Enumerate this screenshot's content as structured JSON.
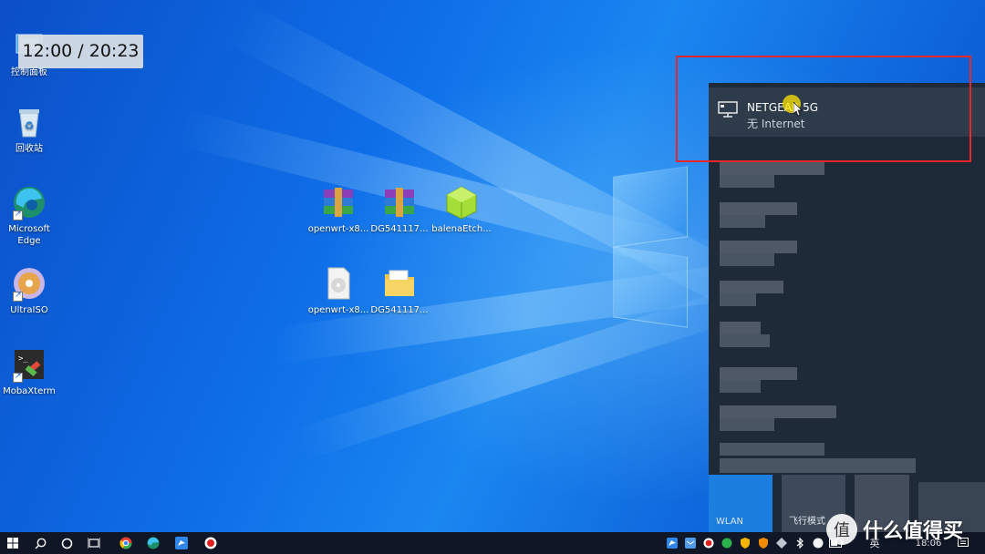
{
  "overlay": {
    "timer": "12:00 / 20:23"
  },
  "desktop_icons": {
    "control_panel": "控制面板",
    "recycle_bin": "回收站",
    "edge": "Microsoft Edge",
    "ultraiso": "UltraISO",
    "mobaxterm": "MobaXterm",
    "openwrt_archive": "openwrt-x8...",
    "dg_archive": "DG541117...",
    "balena": "balenaEtch...",
    "openwrt_image": "openwrt-x8...",
    "dg_folder": "DG541117..."
  },
  "network_flyout": {
    "selected_network": {
      "name": "NETGEAR 5G",
      "status": "无 Internet"
    },
    "quick_actions": {
      "wlan": "WLAN",
      "airplane": "飞行模式"
    }
  },
  "taskbar": {
    "ime": "英",
    "clock": "18:06"
  },
  "watermark": {
    "text": "什么值得买",
    "logo": "值"
  },
  "colors": {
    "highlight": "#e8262b",
    "accent": "#1c7fe0",
    "flyout_bg": "#1f2a38"
  }
}
